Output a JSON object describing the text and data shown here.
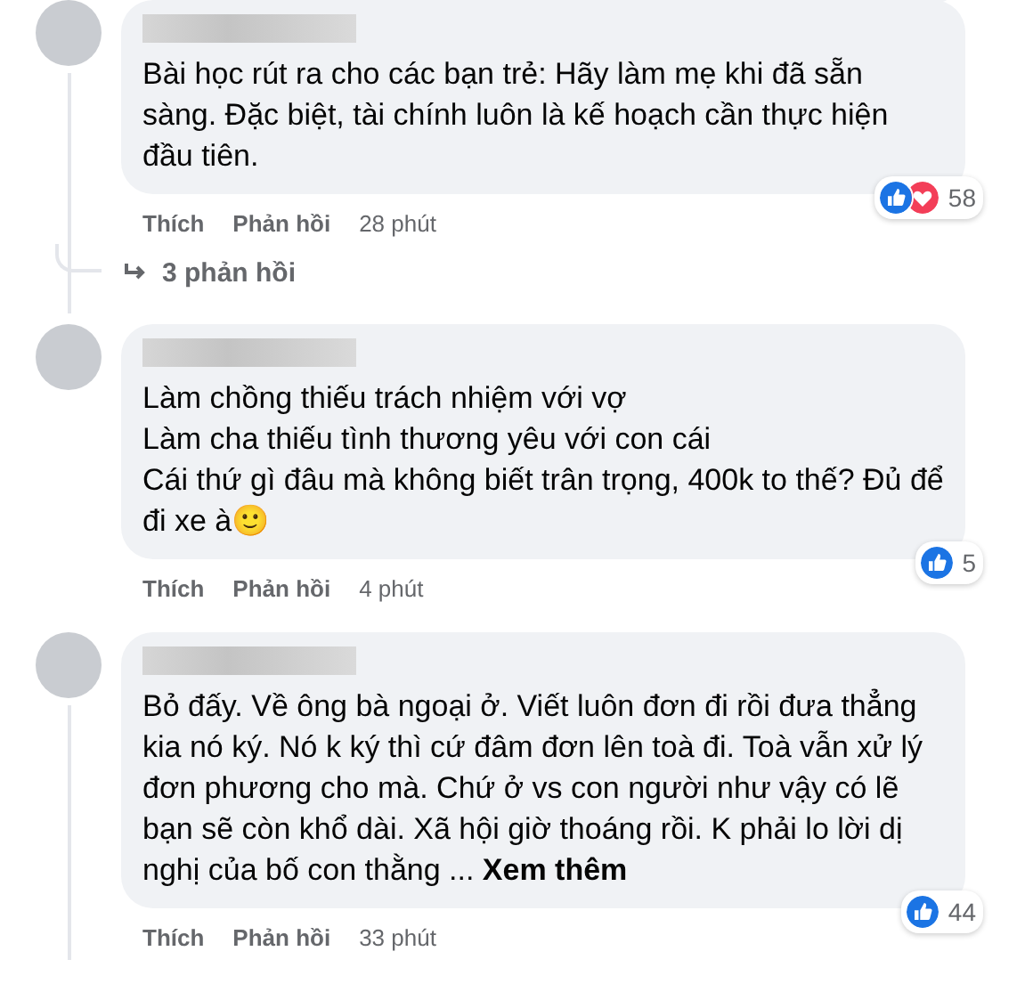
{
  "comments": [
    {
      "text": "Bài học rút ra cho các bạn trẻ: Hãy làm mẹ khi đã sẵn sàng. Đặc biệt, tài chính luôn là kế hoạch cần thực hiện đầu tiên.",
      "reactions": [
        {
          "kind": "like"
        },
        {
          "kind": "love"
        }
      ],
      "reaction_count": "58",
      "actions": [
        "Thích",
        "Phản hồi"
      ],
      "time": "28 phút",
      "replies": "3 phản hồi"
    },
    {
      "text": "Làm chồng thiếu trách nhiệm với vợ\nLàm cha thiếu tình thương yêu với con cái\nCái thứ gì đâu mà không biết trân trọng, 400k to thế? Đủ để đi xe à🙂",
      "reactions": [
        {
          "kind": "like"
        }
      ],
      "reaction_count": "5",
      "actions": [
        "Thích",
        "Phản hồi"
      ],
      "time": "4 phút"
    },
    {
      "text": "Bỏ đấy. Về ông bà ngoại ở. Viết luôn đơn đi rồi đưa thẳng kia nó ký. Nó k ký thì cứ đâm đơn lên toà đi. Toà vẫn xử lý đơn phương cho mà. Chứ ở vs con người như vậy có lẽ bạn sẽ còn khổ dài. Xã hội giờ thoáng rồi. K phải lo lời dị nghị của bố con thằng ... ",
      "see_more": "Xem thêm",
      "reactions": [
        {
          "kind": "like"
        }
      ],
      "reaction_count": "44",
      "actions": [
        "Thích",
        "Phản hồi"
      ],
      "time": "33 phút"
    }
  ]
}
